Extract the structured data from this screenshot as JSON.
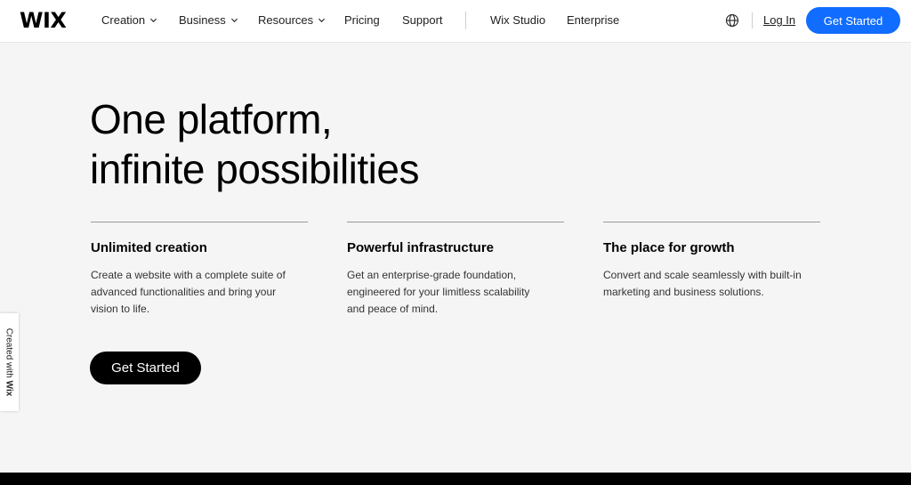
{
  "header": {
    "logo": "WIX",
    "nav": [
      {
        "label": "Creation",
        "has_dropdown": true
      },
      {
        "label": "Business",
        "has_dropdown": true
      },
      {
        "label": "Resources",
        "has_dropdown": true
      },
      {
        "label": "Pricing",
        "has_dropdown": false
      },
      {
        "label": "Support",
        "has_dropdown": false
      }
    ],
    "nav_secondary": [
      {
        "label": "Wix Studio"
      },
      {
        "label": "Enterprise"
      }
    ],
    "language_icon": "globe-icon",
    "login_label": "Log In",
    "cta_label": "Get Started",
    "cta_color": "#116dff"
  },
  "hero": {
    "title_line1": "One platform,",
    "title_line2": "infinite possibilities",
    "features": [
      {
        "title": "Unlimited creation",
        "text": "Create a website with a complete suite of advanced functionalities and bring your vision to life."
      },
      {
        "title": "Powerful infrastructure",
        "text": "Get an enterprise-grade foundation, engineered for your limitless scalability and peace of mind."
      },
      {
        "title": "The place for growth",
        "text": "Convert and scale seamlessly with built-in marketing and business solutions."
      }
    ],
    "cta_label": "Get Started"
  },
  "badge": {
    "prefix": "Created with ",
    "brand": "Wix"
  }
}
